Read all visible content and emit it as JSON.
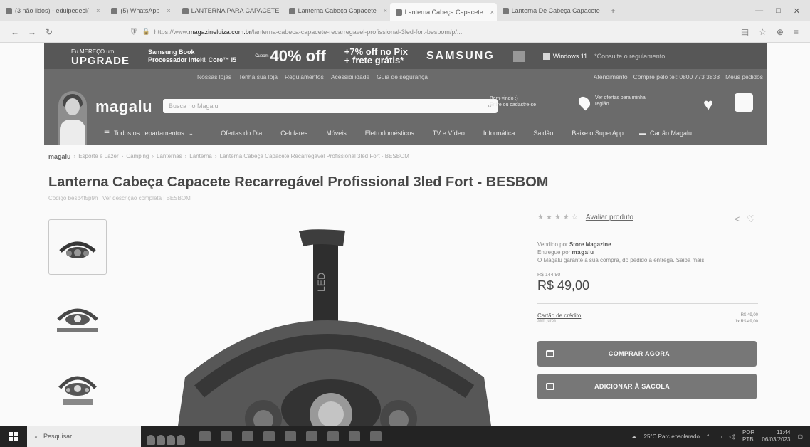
{
  "browser": {
    "tabs": [
      {
        "label": "(3 não lidos) - eduipedecl(",
        "active": false
      },
      {
        "label": "(5) WhatsApp",
        "active": false
      },
      {
        "label": "LANTERNA PARA CAPACETE",
        "active": false
      },
      {
        "label": "Lanterna Cabeça Capacete",
        "active": false
      },
      {
        "label": "Lanterna Cabeça Capacete",
        "active": true
      },
      {
        "label": "Lanterna De Cabeça Capacete",
        "active": false
      }
    ],
    "url_prefix": "https://www.",
    "url_domain": "magazineluiza.com.br",
    "url_path": "/lanterna-cabeca-capacete-recarregavel-profissional-3led-fort-besbom/p/..."
  },
  "promo": {
    "upgrade_small": "Eu MEREÇO um",
    "upgrade": "UPGRADE",
    "samsung_book": "Samsung Book",
    "processor": "Processador Intel® Core™ i5",
    "discount_small": "Cupom",
    "discount": "40% off",
    "pix_line1": "+7% off no Pix",
    "pix_line2": "+ frete grátis*",
    "brand": "SAMSUNG",
    "windows": "Windows 11",
    "disclaimer": "*Consulte o regulamento"
  },
  "header": {
    "links_left": [
      "Nossas lojas",
      "Tenha sua loja",
      "Regulamentos",
      "Acessibilidade",
      "Guia de segurança"
    ],
    "links_right": [
      "Atendimento",
      "Compre pelo tel: 0800 773 3838",
      "Meus pedidos"
    ],
    "logo": "magalu",
    "search_placeholder": "Busca no Magalu",
    "cep_line1": "Bem-vindo :)",
    "cep_line2": "Entre ou cadastre-se",
    "offers_line1": "Ver ofertas para minha",
    "offers_line2": "região",
    "menu_label": "Todos os departamentos",
    "categories": [
      "Ofertas do Dia",
      "Celulares",
      "Móveis",
      "Eletrodomésticos",
      "TV e Vídeo",
      "Informática",
      "Saldão",
      "Baixe o SuperApp"
    ],
    "card_link": "Cartão Magalu"
  },
  "breadcrumb": [
    "magalu",
    "Esporte e Lazer",
    "Camping",
    "Lanternas",
    "Lanterna",
    "Lanterna Cabeça Capacete Recarregável Profissional 3led Fort - BESBOM"
  ],
  "product": {
    "title": "Lanterna Cabeça Capacete Recarregável Profissional 3led Fort - BESBOM",
    "code": "Código besb4f5p9h | Ver descrição completa | BESBOM",
    "rate_link": "Avaliar produto",
    "sold_by_label": "Vendido por",
    "sold_by": "Store Magazine",
    "delivered_label": "Entregue por",
    "delivered_by": "magalu",
    "guarantee": "O Magalu garante a sua compra, do pedido à entrega. Saiba mais",
    "old_price": "R$ 144,90",
    "price": "R$ 49,00",
    "card_label": "Cartão de crédito",
    "card_sub": "sem juros",
    "card_right1": "R$ 49,00",
    "card_right2": "1x R$ 49,00",
    "buy_now": "COMPRAR AGORA",
    "add_bag": "ADICIONAR À SACOLA"
  },
  "taskbar": {
    "search": "Pesquisar",
    "weather": "25°C  Parc ensolarado",
    "lang1": "POR",
    "lang2": "PTB",
    "time": "11:44",
    "date": "06/03/2023"
  }
}
